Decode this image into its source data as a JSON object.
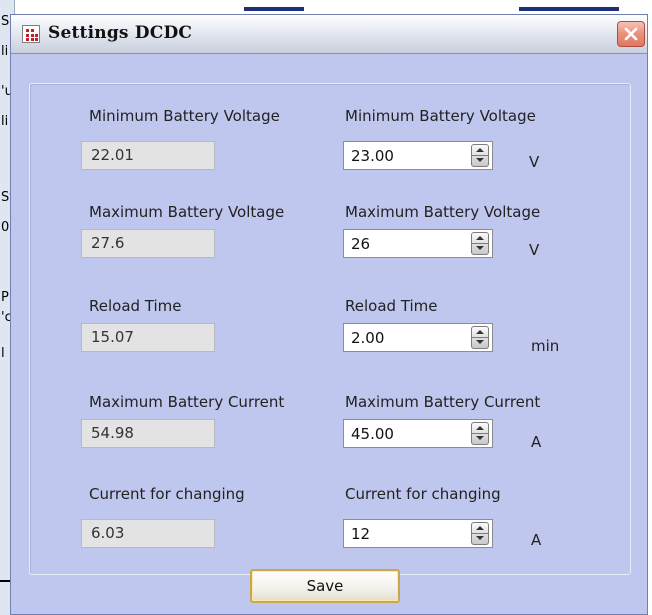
{
  "background": {
    "left_strip_chars": [
      "S",
      "li",
      "'u",
      "li",
      "Sf",
      "0",
      "P",
      "'c",
      "l"
    ]
  },
  "dialog": {
    "title": "Settings DCDC",
    "app_icon": "grid-app-icon",
    "close_icon": "close-icon",
    "save_label": "Save"
  },
  "rows": [
    {
      "current_label": "Minimum Battery Voltage",
      "current_value": "22.01",
      "setting_label": "Minimum Battery Voltage",
      "setting_value": "23.00",
      "unit": "V"
    },
    {
      "current_label": "Maximum Battery Voltage",
      "current_value": "27.6",
      "setting_label": "Maximum Battery Voltage",
      "setting_value": "26",
      "unit": "V"
    },
    {
      "current_label": "Reload Time",
      "current_value": "15.07",
      "setting_label": "Reload Time",
      "setting_value": "2.00",
      "unit": "min"
    },
    {
      "current_label": "Maximum Battery Current",
      "current_value": "54.98",
      "setting_label": "Maximum Battery Current",
      "setting_value": "45.00",
      "unit": "A"
    },
    {
      "current_label": "Current for changing",
      "current_value": "6.03",
      "setting_label": "Current for changing",
      "setting_value": "12",
      "unit": "A"
    }
  ],
  "colors": {
    "dialog_bg": "#c0c7ee",
    "close_button": "#df7a63",
    "save_border": "#c9a84b"
  }
}
